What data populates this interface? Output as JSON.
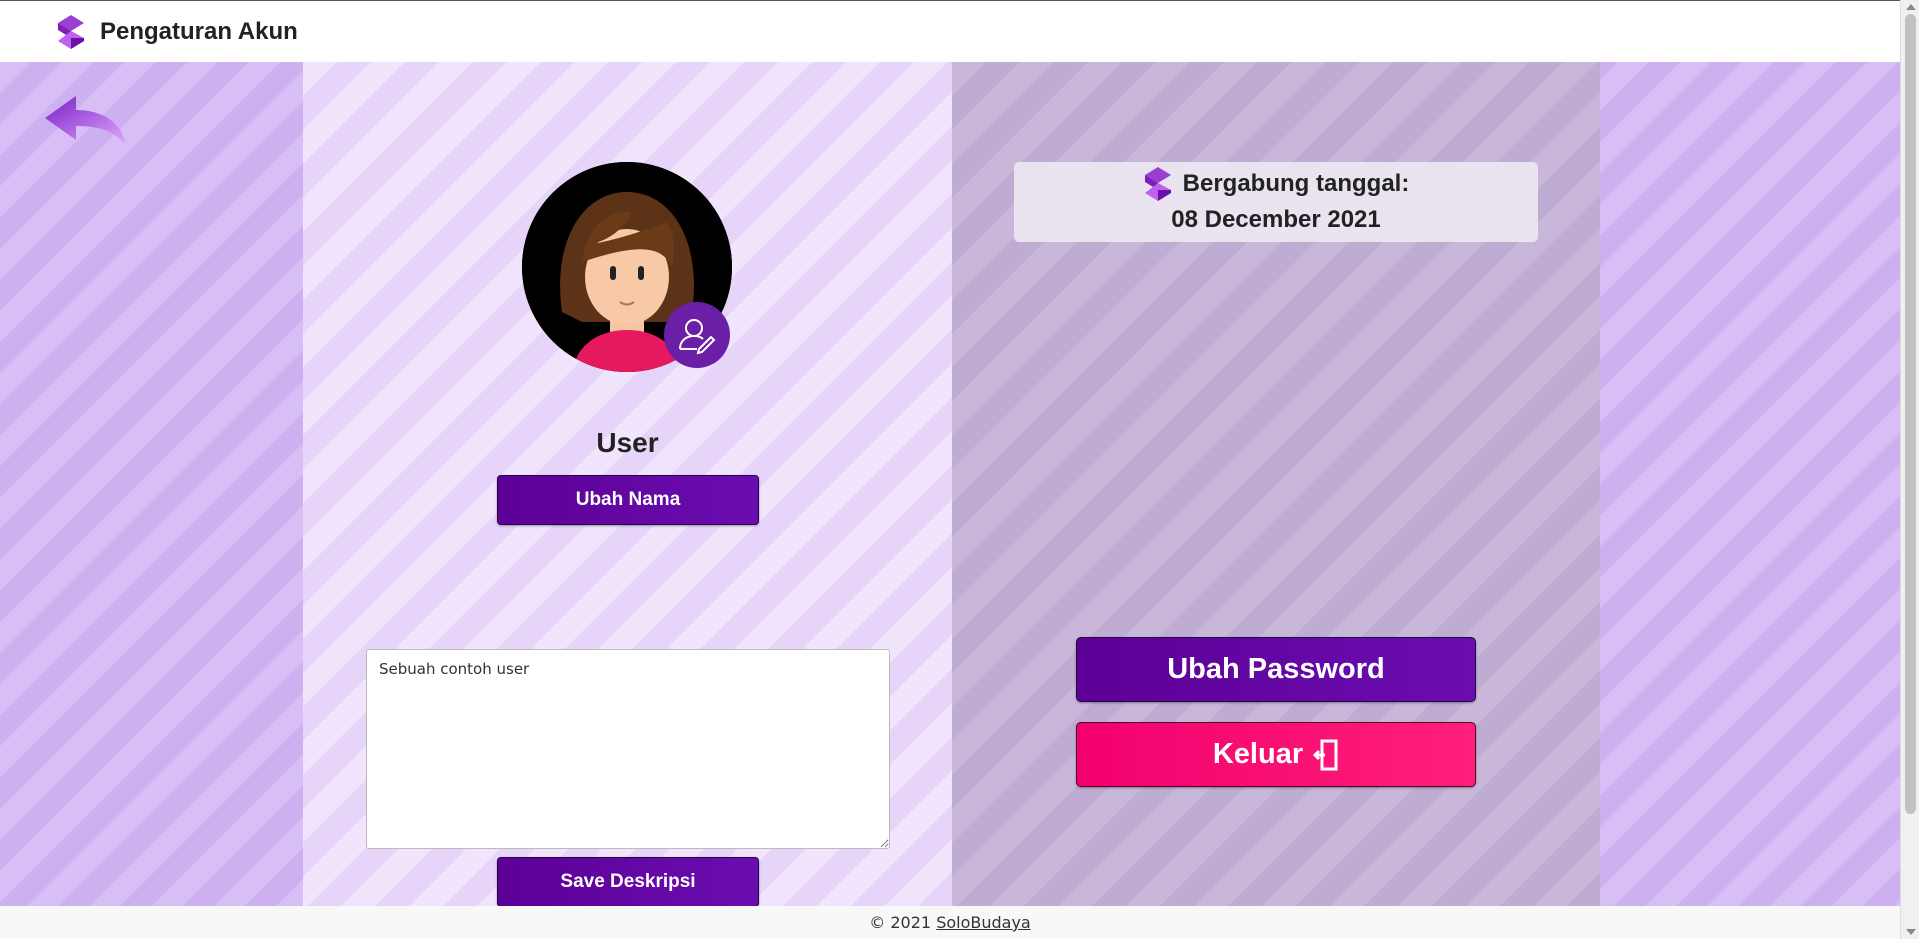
{
  "header": {
    "title": "Pengaturan Akun",
    "logo_icon": "solobudaya-logo-icon"
  },
  "colors": {
    "brand_purple": "#5c0096",
    "accent_pink": "#f2006e",
    "page_bg": "#d3b8f5",
    "left_panel_bg": "#ebdcfc",
    "right_panel_bg": "#c3b1d6"
  },
  "profile": {
    "username": "User",
    "rename_label": "Ubah Nama",
    "description": "Sebuah contoh user",
    "save_description_label": "Save Deskripsi",
    "avatar_edit_icon": "user-edit-icon"
  },
  "account": {
    "joined_label": "Bergabung tanggal:",
    "joined_date": "08 December 2021",
    "change_password_label": "Ubah Password",
    "logout_label": "Keluar",
    "logout_icon": "door-exit-icon"
  },
  "navigation": {
    "back_icon": "back-arrow-icon"
  },
  "footer": {
    "copyright": "© 2021",
    "brand_link": "SoloBudaya"
  }
}
